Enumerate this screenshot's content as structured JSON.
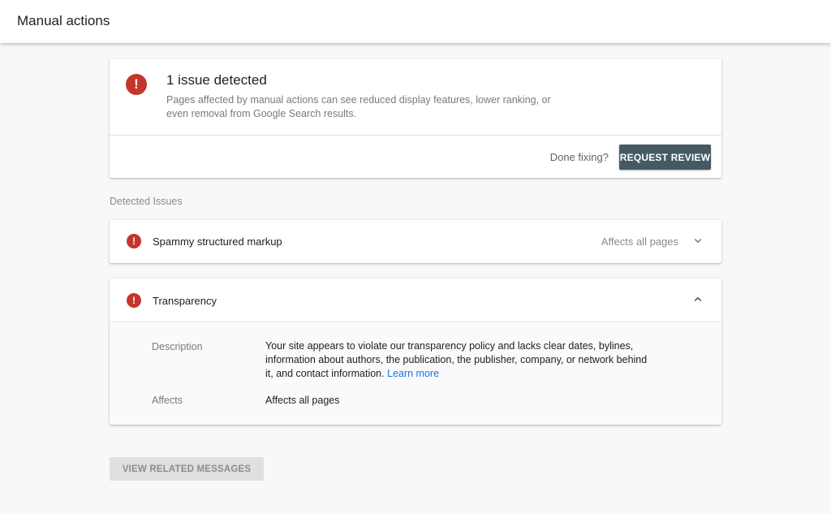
{
  "header": {
    "title": "Manual actions"
  },
  "summary": {
    "icon": "alert-icon",
    "title": "1 issue detected",
    "description": "Pages affected by manual actions can see reduced display features, lower ranking, or even removal from Google Search results.",
    "done_fixing_label": "Done fixing?",
    "request_review_label": "REQUEST REVIEW"
  },
  "detected_issues": {
    "label": "Detected Issues",
    "items": [
      {
        "name": "Spammy structured markup",
        "affects": "Affects all pages",
        "expanded": false,
        "chevron": "chevron-down-icon"
      },
      {
        "name": "Transparency",
        "expanded": true,
        "chevron": "chevron-up-icon",
        "description_label": "Description",
        "description_text": "Your site appears to violate our transparency policy and lacks clear dates, bylines, information about authors, the publication, the publisher, company, or network behind it, and contact information.",
        "learn_more": "Learn more",
        "affects_label": "Affects",
        "affects_value": "Affects all pages"
      }
    ]
  },
  "footer": {
    "view_related_label": "VIEW RELATED MESSAGES"
  },
  "colors": {
    "alert": "#c5352a",
    "primary_button": "#455a64",
    "link": "#1a73e8",
    "disabled_button": "#e0e0e0"
  }
}
